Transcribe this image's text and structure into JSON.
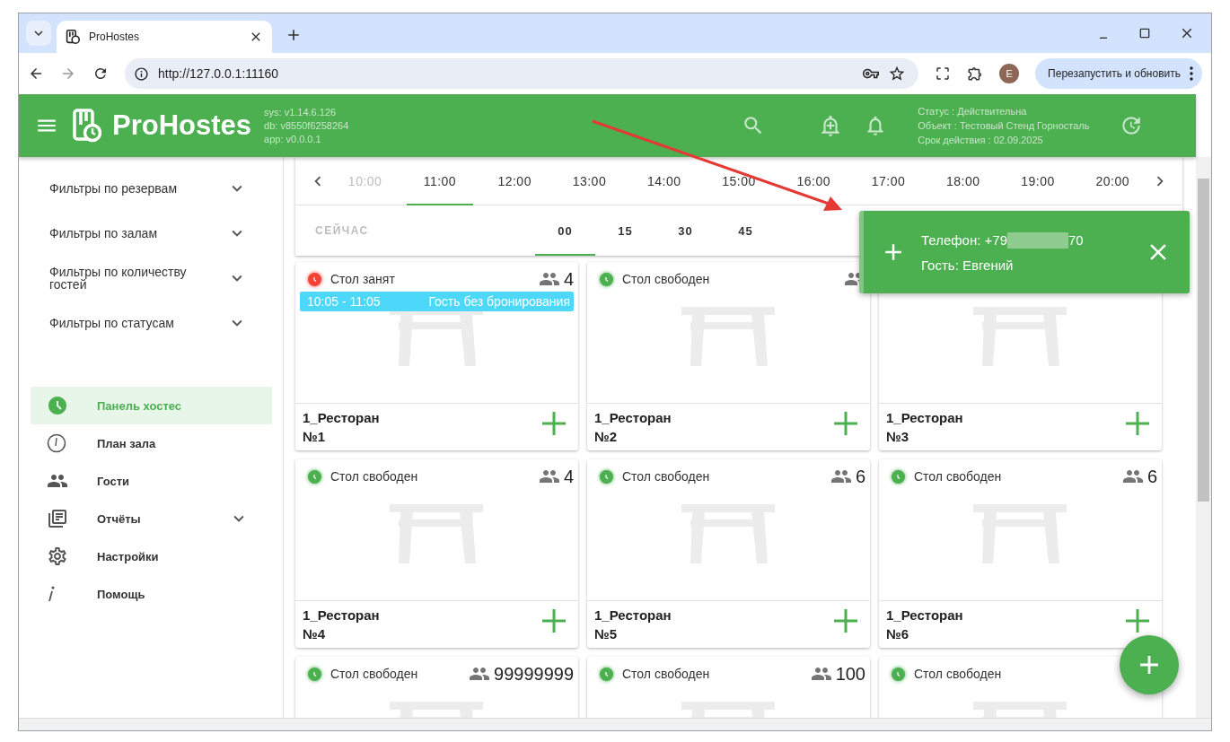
{
  "browser": {
    "tab_title": "ProHostes",
    "url": "http://127.0.0.1:11160",
    "profile_initial": "E",
    "update_button": "Перезапустить и обновить"
  },
  "header": {
    "title": "ProHostes",
    "versions": [
      "sys: v1.14.6.126",
      "db: v8550f6258264",
      "app: v0.0.0.1"
    ],
    "status_lines": [
      "Статус : Действительна",
      "Объект : Тестовый Стенд Горносталь",
      "Срок действия : 02.09.2025"
    ]
  },
  "sidebar": {
    "filters": [
      {
        "label": "Фильтры по резервам",
        "expanded": false
      },
      {
        "label": "Фильтры по залам",
        "expanded": false
      },
      {
        "label": "Фильтры по количеству гостей",
        "expanded": false
      },
      {
        "label": "Фильтры по статусам",
        "expanded": false
      }
    ],
    "items": [
      {
        "label": "Панель хостес",
        "kind": "dashboard",
        "selected": true
      },
      {
        "label": "План зала",
        "kind": "plan",
        "selected": false
      },
      {
        "label": "Гости",
        "kind": "guests",
        "selected": false
      },
      {
        "label": "Отчёты",
        "kind": "reports",
        "selected": false,
        "expandable": true
      },
      {
        "label": "Настройки",
        "kind": "settings",
        "selected": false
      },
      {
        "label": "Помощь",
        "kind": "help",
        "selected": false
      }
    ]
  },
  "timeline": {
    "hours": [
      {
        "label": "10:00",
        "selected": false,
        "disabled": true
      },
      {
        "label": "11:00",
        "selected": true,
        "disabled": false
      },
      {
        "label": "12:00",
        "selected": false,
        "disabled": false
      },
      {
        "label": "13:00",
        "selected": false,
        "disabled": false
      },
      {
        "label": "14:00",
        "selected": false,
        "disabled": false
      },
      {
        "label": "15:00",
        "selected": false,
        "disabled": false
      },
      {
        "label": "16:00",
        "selected": false,
        "disabled": false
      },
      {
        "label": "17:00",
        "selected": false,
        "disabled": false
      },
      {
        "label": "18:00",
        "selected": false,
        "disabled": false
      },
      {
        "label": "19:00",
        "selected": false,
        "disabled": false
      },
      {
        "label": "20:00",
        "selected": false,
        "disabled": false
      }
    ],
    "now_label": "СЕЙЧАС",
    "minutes": [
      {
        "label": "00",
        "selected": true
      },
      {
        "label": "15",
        "selected": false
      },
      {
        "label": "30",
        "selected": false
      },
      {
        "label": "45",
        "selected": false
      }
    ]
  },
  "tables": [
    {
      "color": "#f44336",
      "status_text": "Стол занят",
      "capacity": "4",
      "reservation": {
        "time": "10:05 - 11:05",
        "guest": "Гость без бронирования"
      },
      "hall": "1_Ресторан",
      "number": "№1"
    },
    {
      "color": "#4caf50",
      "status_text": "Стол свободен",
      "hall": "1_Ресторан",
      "number": "№2"
    },
    {
      "hall": "1_Ресторан",
      "number": "№3"
    },
    {
      "color": "#4caf50",
      "status_text": "Стол свободен",
      "capacity": "4",
      "hall": "1_Ресторан",
      "number": "№4"
    },
    {
      "color": "#4caf50",
      "status_text": "Стол свободен",
      "capacity": "6",
      "hall": "1_Ресторан",
      "number": "№5"
    },
    {
      "color": "#4caf50",
      "status_text": "Стол свободен",
      "capacity": "6",
      "hall": "1_Ресторан",
      "number": "№6"
    },
    {
      "color": "#4caf50",
      "status_text": "Стол свободен",
      "capacity": "99999999"
    },
    {
      "color": "#4caf50",
      "status_text": "Стол свободен",
      "capacity": "100"
    },
    {
      "color": "#4caf50",
      "status_text": "Стол свободен"
    }
  ],
  "toast": {
    "phone_start": "Телефон: +79",
    "phone_end": "70",
    "guest": "Гость: Евгений"
  }
}
